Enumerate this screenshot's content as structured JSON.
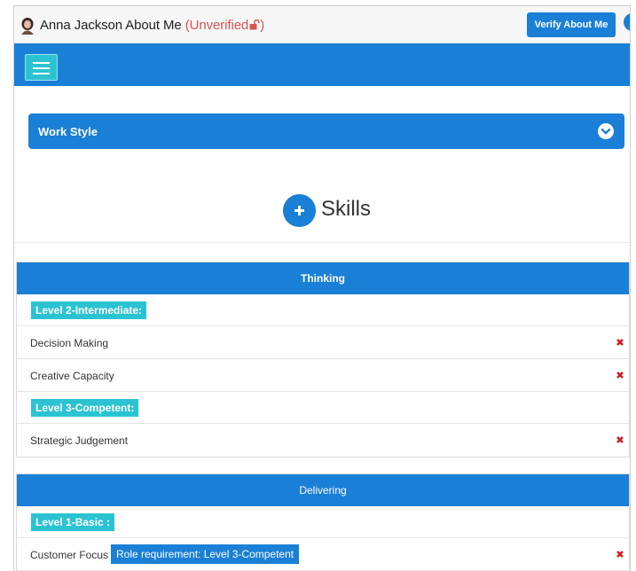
{
  "header": {
    "name_title": "Anna Jackson About Me",
    "status": "(Unverified",
    "status_close": ")",
    "verify_label": "Verify About Me"
  },
  "work_style": {
    "label": "Work Style"
  },
  "skills": {
    "title": "Skills"
  },
  "panels": [
    {
      "title": "Thinking",
      "groups": [
        {
          "level": "Level 2-Intermediate:",
          "items": [
            {
              "name": "Decision Making"
            },
            {
              "name": "Creative Capacity"
            }
          ]
        },
        {
          "level": "Level 3-Competent:",
          "items": [
            {
              "name": "Strategic Judgement"
            }
          ]
        }
      ]
    },
    {
      "title": "Delivering",
      "groups": [
        {
          "level": "Level 1-Basic :",
          "items": [
            {
              "name": "Customer Focus",
              "requirement": "Role requirement: Level 3-Competent"
            }
          ]
        }
      ]
    }
  ],
  "colors": {
    "primary": "#1a7fd6",
    "accent": "#2bc3d1",
    "danger": "#d9534f",
    "remove": "#cc1f1f"
  },
  "icons": {
    "avatar": "user-avatar-icon",
    "lock": "unlocked-icon",
    "menu": "hamburger-menu-icon",
    "expand": "chevron-down-circle-icon",
    "add": "plus-circle-icon",
    "remove": "close-x-icon"
  }
}
